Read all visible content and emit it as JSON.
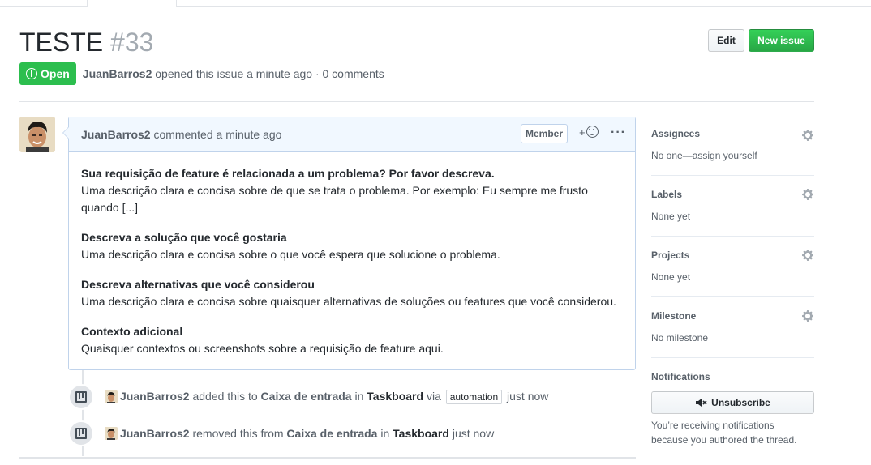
{
  "issue": {
    "title": "TESTE",
    "number": "#33",
    "state": "Open",
    "author": "JuanBarros2",
    "opened_text": "opened this issue a minute ago · 0 comments"
  },
  "actions": {
    "edit_label": "Edit",
    "new_issue_label": "New issue"
  },
  "comment": {
    "author": "JuanBarros2",
    "time_text": "commented a minute ago",
    "role": "Member",
    "reaction_plus": "+",
    "more": "···",
    "sections": [
      {
        "heading": "Sua requisição de feature é relacionada a um problema? Por favor descreva.",
        "text": "Uma descrição clara e concisa sobre de que se trata o problema. Por exemplo: Eu sempre me frusto quando [...]"
      },
      {
        "heading": "Descreva a solução que você gostaria",
        "text": "Uma descrição clara e concisa sobre o que você espera que solucione o problema."
      },
      {
        "heading": "Descreva alternativas que você considerou",
        "text": "Uma descrição clara e concisa sobre quaisquer alternativas de soluções ou features que você considerou."
      },
      {
        "heading": "Contexto adicional",
        "text": "Quaisquer contextos ou screenshots sobre a requisição de feature aqui."
      }
    ]
  },
  "events": [
    {
      "author": "JuanBarros2",
      "verb": "added this to",
      "column": "Caixa de entrada",
      "in": "in",
      "board": "Taskboard",
      "via": "via",
      "label": "automation",
      "time": "just now"
    },
    {
      "author": "JuanBarros2",
      "verb": "removed this from",
      "column": "Caixa de entrada",
      "in": "in",
      "board": "Taskboard",
      "time": "just now"
    }
  ],
  "sidebar": {
    "assignees": {
      "title": "Assignees",
      "value": "No one—assign yourself"
    },
    "labels": {
      "title": "Labels",
      "value": "None yet"
    },
    "projects": {
      "title": "Projects",
      "value": "None yet"
    },
    "milestone": {
      "title": "Milestone",
      "value": "No milestone"
    },
    "notifications": {
      "title": "Notifications",
      "button": "Unsubscribe",
      "reason": "You’re receiving notifications because you authored the thread."
    }
  },
  "colors": {
    "open_green": "#2cbe4e",
    "new_issue_green": "#28a745",
    "comment_header": "#f1f8ff"
  }
}
